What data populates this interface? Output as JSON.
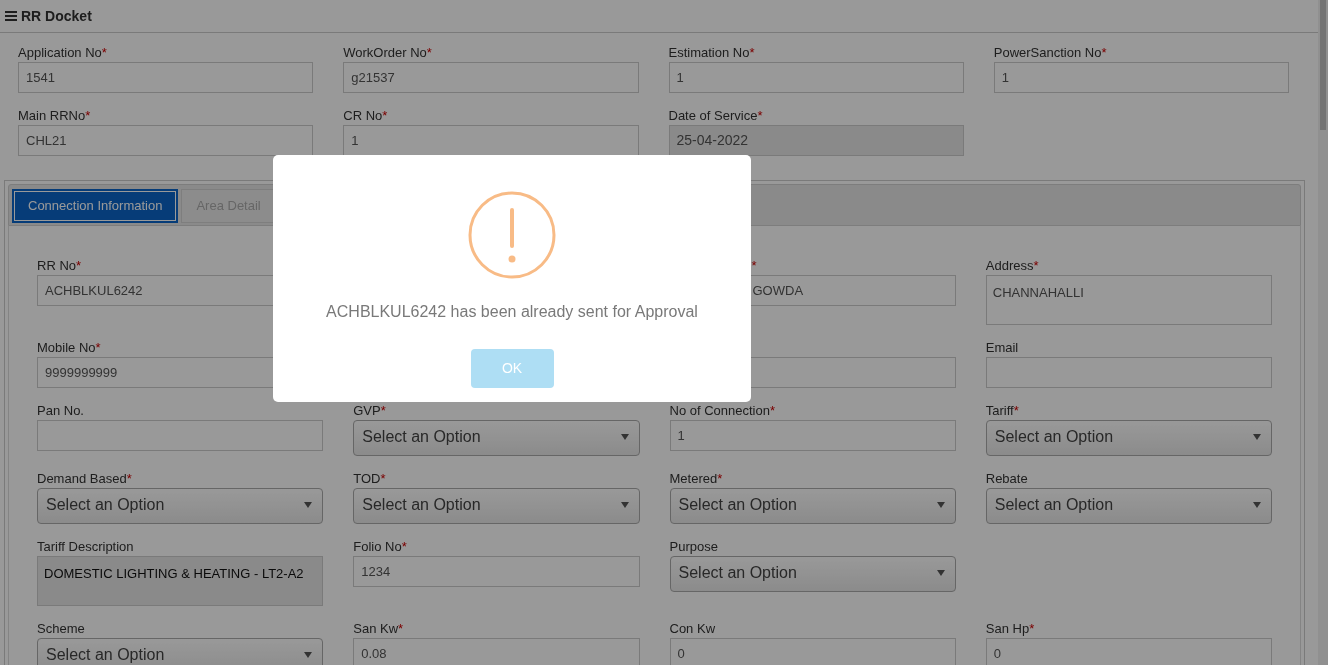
{
  "header": {
    "title": "RR Docket"
  },
  "top_fields": [
    {
      "label": "Application No",
      "mark": "*",
      "value": "1541",
      "disabled": false
    },
    {
      "label": "WorkOrder No",
      "mark": "*",
      "value": "g21537",
      "disabled": false
    },
    {
      "label": "Estimation No",
      "mark": "*",
      "value": "1",
      "disabled": false
    },
    {
      "label": "PowerSanction No",
      "mark": "*",
      "value": "1",
      "disabled": false
    },
    {
      "label": "Main RRNo",
      "mark": "*",
      "value": "CHL21",
      "disabled": false
    },
    {
      "label": "CR No",
      "mark": "*",
      "value": "1",
      "disabled": false
    },
    {
      "label": "Date of Service",
      "mark": "*",
      "value": "25-04-2022",
      "disabled": true
    }
  ],
  "tabs": [
    {
      "label": "Connection Information",
      "selected": true
    },
    {
      "label": "Area Detail",
      "selected": false
    }
  ],
  "connection_rows": [
    [
      {
        "kind": "input",
        "label": "RR No",
        "mark": "*",
        "value": "ACHBLKUL6242"
      },
      {
        "kind": "empty"
      },
      {
        "kind": "input",
        "mark": "*",
        "value": "GOWDA"
      },
      {
        "kind": "textarea",
        "label": "Address",
        "mark": "*",
        "value": "CHANNAHALLI"
      }
    ],
    [
      {
        "kind": "input",
        "label": "Mobile No",
        "mark": "*",
        "value": "9999999999"
      },
      {
        "kind": "empty"
      },
      {
        "kind": "input"
      },
      {
        "kind": "input",
        "label": "Email"
      }
    ],
    [
      {
        "kind": "input",
        "label": "Pan No."
      },
      {
        "kind": "select",
        "label": "GVP",
        "mark": "*",
        "value": "Select an Option"
      },
      {
        "kind": "input",
        "label": "No of Connection",
        "mark": "*",
        "value": "1"
      },
      {
        "kind": "select",
        "label": "Tariff",
        "mark": "*",
        "value": "Select an Option"
      }
    ],
    [
      {
        "kind": "select",
        "label": "Demand Based",
        "mark": "*",
        "value": "Select an Option"
      },
      {
        "kind": "select",
        "label": "TOD",
        "mark": "*",
        "value": "Select an Option"
      },
      {
        "kind": "select",
        "label": "Metered",
        "mark": "*",
        "value": "Select an Option"
      },
      {
        "kind": "select",
        "label": "Rebate",
        "value": "Select an Option"
      }
    ],
    [
      {
        "kind": "textarea",
        "label": "Tariff Description",
        "value": "DOMESTIC LIGHTING & HEATING - LT2-A2",
        "disabled": true
      },
      {
        "kind": "input",
        "label": "Folio No",
        "mark": "*",
        "value": "1234"
      },
      {
        "kind": "select",
        "label": "Purpose",
        "value": "Select an Option"
      },
      {
        "kind": "empty"
      }
    ],
    [
      {
        "kind": "select",
        "label": "Scheme",
        "value": "Select an Option"
      },
      {
        "kind": "input",
        "label": "San Kw",
        "mark": "*",
        "value": "0.08"
      },
      {
        "kind": "input",
        "label": "Con Kw",
        "value": "0"
      },
      {
        "kind": "input",
        "label": "San Hp",
        "mark": "*",
        "value": "0"
      }
    ]
  ],
  "dialog": {
    "message": "ACHBLKUL6242 has been already sent for Approval",
    "button": "OK"
  }
}
